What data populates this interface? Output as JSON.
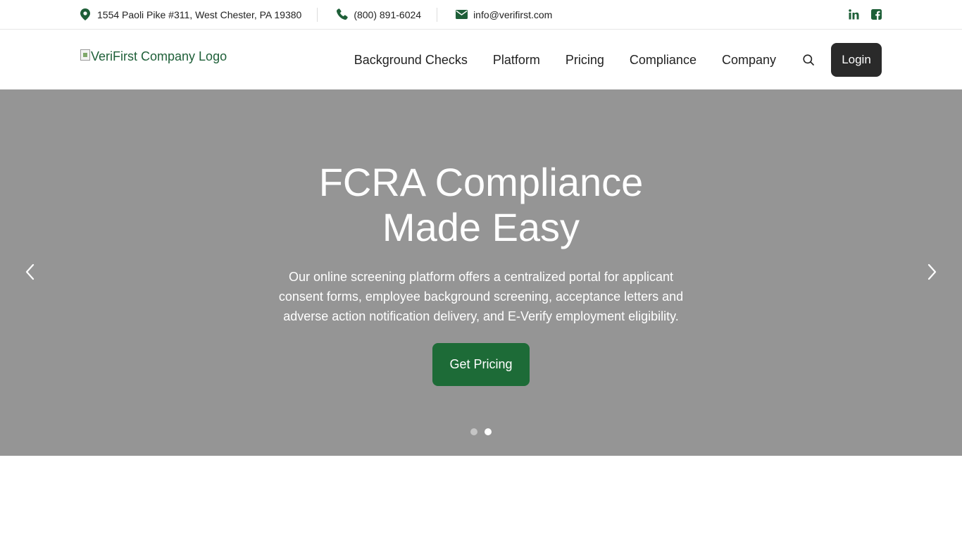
{
  "topbar": {
    "address": "1554 Paoli Pike #311, West Chester, PA 19380",
    "phone": "(800) 891-6024",
    "email": "info@verifirst.com",
    "icons": {
      "address": "map-pin-icon",
      "phone": "phone-icon",
      "email": "envelope-icon",
      "social": [
        "linkedin-icon",
        "facebook-icon"
      ]
    }
  },
  "header": {
    "logo_alt": "VeriFirst Company Logo",
    "nav": [
      "Background Checks",
      "Platform",
      "Pricing",
      "Compliance",
      "Company"
    ],
    "search_icon": "search-icon",
    "login_label": "Login"
  },
  "hero": {
    "title_line1": "FCRA Compliance",
    "title_line2": "Made Easy",
    "description": "Our online screening platform offers a centralized portal for applicant consent forms, employee background screening, acceptance letters and adverse action notification delivery, and E-Verify employment eligibility.",
    "cta_label": "Get Pricing",
    "slides_total": 2,
    "active_slide": 2
  },
  "colors": {
    "brand_green": "#1d6b37",
    "icon_green": "#1e5f38",
    "hero_bg": "#959595",
    "login_bg": "#2a2a2a"
  }
}
